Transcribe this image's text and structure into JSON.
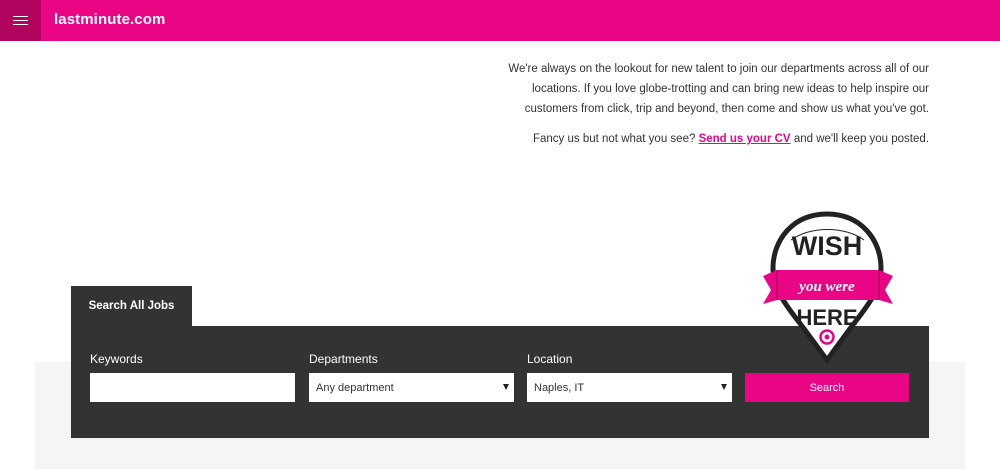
{
  "header": {
    "brand": "lastminute.com",
    "menu_icon": "hamburger-icon"
  },
  "intro": {
    "paragraph": "We're always on the lookout for new talent to join our departments across all of our locations. If you love globe-trotting and can bring new ideas to help inspire our customers from click, trip and beyond, then come and show us what you've got.",
    "cv_prefix": "Fancy us but not what you see?",
    "cv_link": "Send us your CV",
    "cv_suffix": "and we'll keep you posted."
  },
  "badge": {
    "line1": "WISH",
    "line2": "you were",
    "line3": "HERE"
  },
  "search": {
    "tab_label": "Search All Jobs",
    "keywords_label": "Keywords",
    "keywords_value": "",
    "departments_label": "Departments",
    "departments_value": "Any department",
    "location_label": "Location",
    "location_value": "Naples, IT",
    "button_label": "Search"
  },
  "colors": {
    "brand_pink": "#ea0584",
    "dark_panel": "#333333"
  }
}
